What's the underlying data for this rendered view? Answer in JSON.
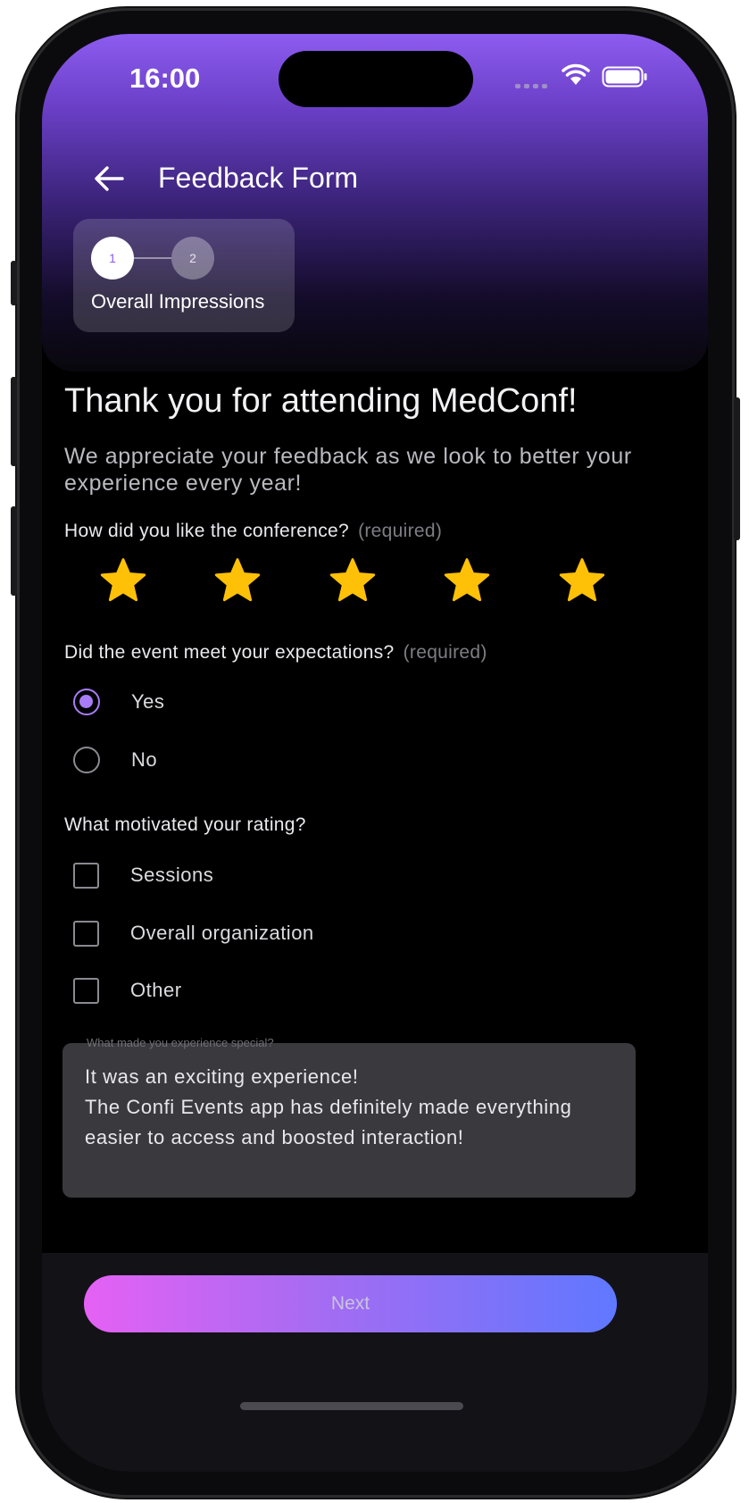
{
  "status_bar": {
    "time": "16:00"
  },
  "header": {
    "title": "Feedback Form"
  },
  "stepper": {
    "step1": "1",
    "step2": "2",
    "current_label": "Overall Impressions"
  },
  "intro": {
    "headline": "Thank you for attending MedConf!",
    "subtext": "We appreciate your feedback as we look to better your experience every year!"
  },
  "q1": {
    "text": "How did you like the conference?",
    "required": "(required)",
    "rating": 5,
    "max_rating": 5
  },
  "q2": {
    "text": "Did the event meet your expectations?",
    "required": "(required)",
    "options": [
      {
        "label": "Yes",
        "selected": true
      },
      {
        "label": "No",
        "selected": false
      }
    ]
  },
  "q3": {
    "text": "What motivated your rating?",
    "options": [
      {
        "label": "Sessions",
        "checked": false
      },
      {
        "label": "Overall organization",
        "checked": false
      },
      {
        "label": "Other",
        "checked": false
      }
    ]
  },
  "q4": {
    "label": "What made you experience special?",
    "value": "It was an exciting experience!\nThe Confi Events app has definitely made everything easier to access and boosted interaction!"
  },
  "footer": {
    "next_label": "Next"
  },
  "colors": {
    "accent": "#a87cf6",
    "star": "#ffc107",
    "gradient_start": "#e561f4",
    "gradient_end": "#5f78ff"
  }
}
